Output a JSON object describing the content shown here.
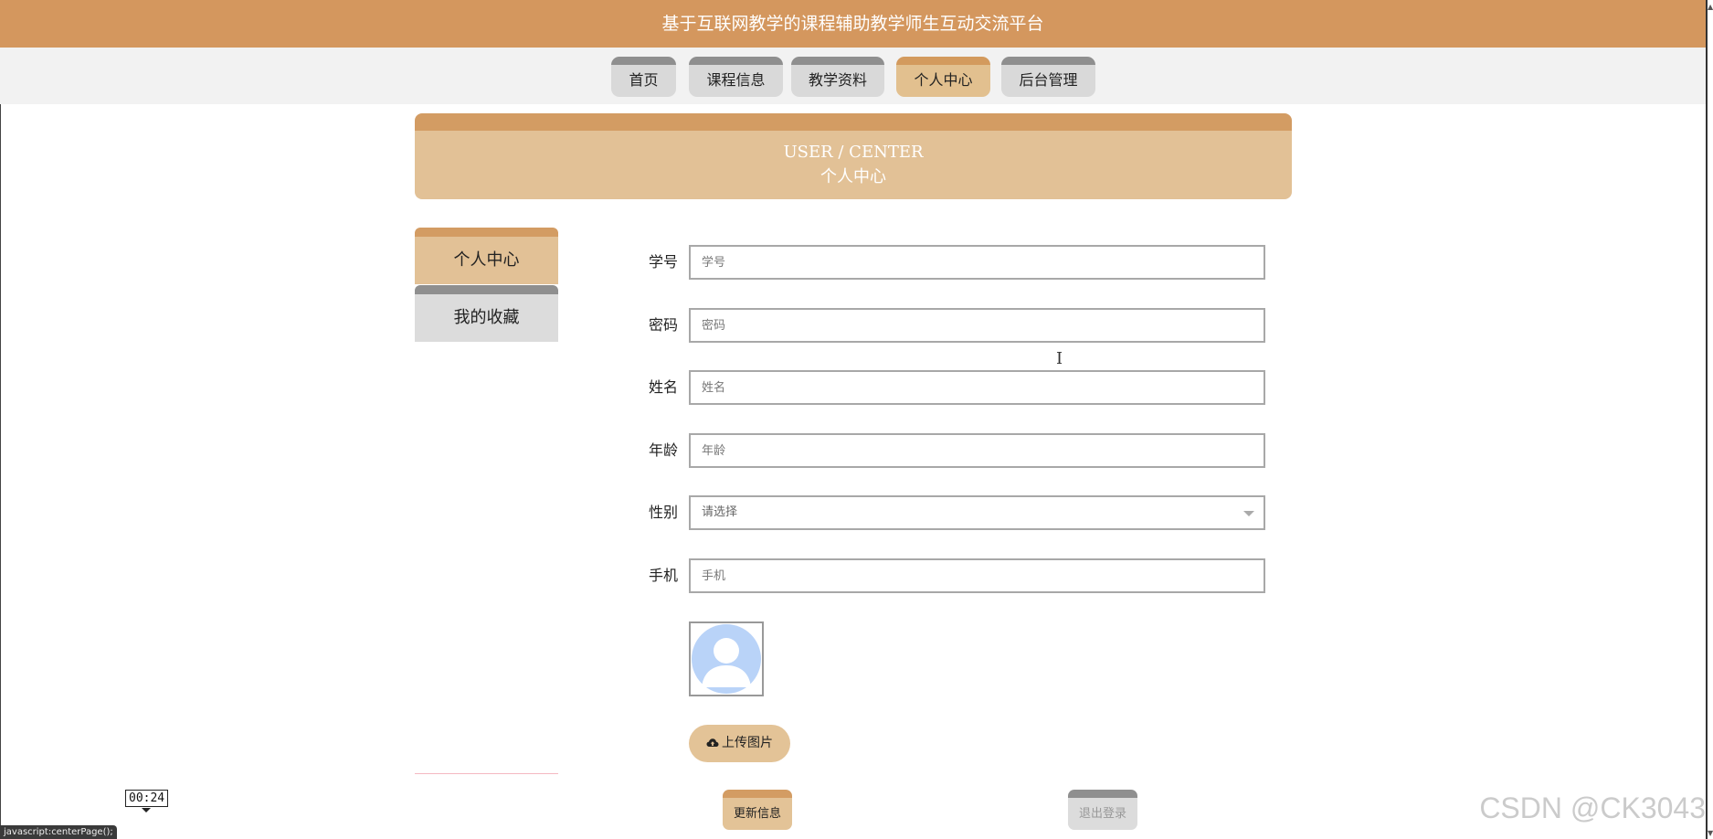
{
  "header": {
    "title": "基于互联网教学的课程辅助教学师生互动交流平台"
  },
  "nav": {
    "items": [
      {
        "label": "首页"
      },
      {
        "label": "课程信息"
      },
      {
        "label": "教学资料"
      },
      {
        "label": "个人中心"
      },
      {
        "label": "后台管理"
      }
    ]
  },
  "banner": {
    "en": "USER / CENTER",
    "zh": "个人中心"
  },
  "sidebar": {
    "items": [
      {
        "label": "个人中心"
      },
      {
        "label": "我的收藏"
      }
    ]
  },
  "form": {
    "fields": [
      {
        "label": "学号",
        "placeholder": "学号",
        "value": ""
      },
      {
        "label": "密码",
        "placeholder": "密码",
        "value": ""
      },
      {
        "label": "姓名",
        "placeholder": "姓名",
        "value": ""
      },
      {
        "label": "年龄",
        "placeholder": "年龄",
        "value": ""
      },
      {
        "label": "性别",
        "placeholder": "请选择",
        "value": ""
      },
      {
        "label": "手机",
        "placeholder": "手机",
        "value": ""
      }
    ],
    "upload_label": "上传图片",
    "update_label": "更新信息",
    "logout_label": "退出登录"
  },
  "overlay": {
    "timer": "00:24",
    "status_text": "javascript:centerPage();",
    "watermark": "CSDN @CK3043"
  },
  "colors": {
    "header_bg": "#d4975e",
    "accent_light": "#e2c196",
    "accent_dark": "#d39c63",
    "inactive_gray": "#d9d9d9"
  },
  "icons": {
    "upload": "cloud-upload-icon",
    "avatar": "default-avatar-icon",
    "select": "chevron-down-icon"
  }
}
